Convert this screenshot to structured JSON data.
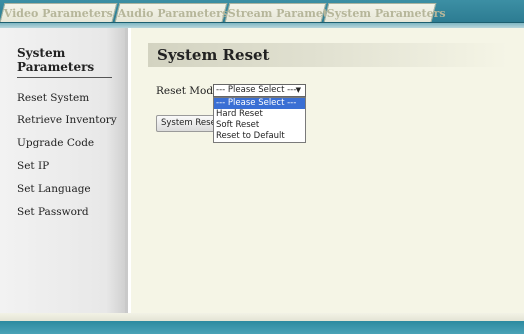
{
  "tabs": [
    {
      "label": "Video Parameters"
    },
    {
      "label": "Audio Parameters"
    },
    {
      "label": "Stream Parameters"
    },
    {
      "label": "System Parameters"
    }
  ],
  "sidebar": {
    "title": "System Parameters",
    "items": [
      {
        "label": "Reset System"
      },
      {
        "label": "Retrieve Inventory"
      },
      {
        "label": "Upgrade Code"
      },
      {
        "label": "Set IP"
      },
      {
        "label": "Set Language"
      },
      {
        "label": "Set Password"
      }
    ]
  },
  "main": {
    "title": "System Reset",
    "reset_mode_label": "Reset Mode :",
    "select_value": "--- Please Select ---",
    "options": [
      {
        "label": "--- Please Select ---",
        "selected": true
      },
      {
        "label": "Hard Reset",
        "selected": false
      },
      {
        "label": "Soft Reset",
        "selected": false
      },
      {
        "label": "Reset to Default",
        "selected": false
      }
    ],
    "button_label": "System Reset"
  },
  "colors": {
    "tab_bar": "#2d7c92",
    "main_bg": "#f5f5e6",
    "selected_option": "#3a6fd4"
  }
}
